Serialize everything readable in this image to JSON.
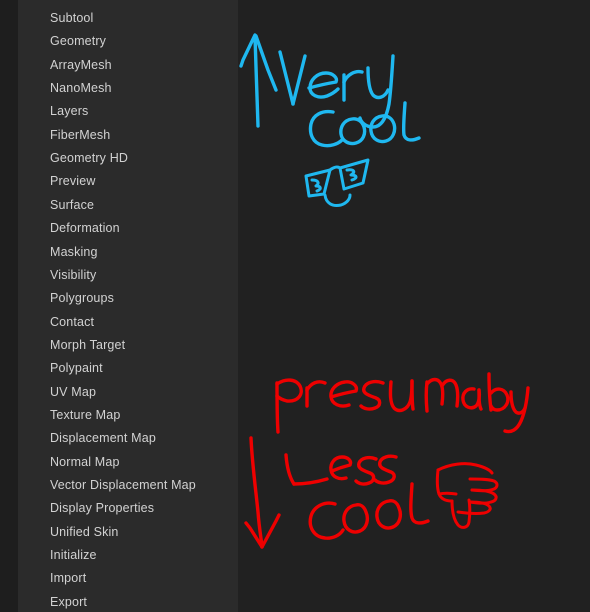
{
  "window": {
    "background_color": "#212121",
    "panel_color": "#2b2b2b",
    "gutter_color": "#1e1e1e",
    "text_color": "#d2d2d2"
  },
  "menu": {
    "name": "tool-palette-menu",
    "items": [
      {
        "label": "Subtool"
      },
      {
        "label": "Geometry"
      },
      {
        "label": "ArrayMesh"
      },
      {
        "label": "NanoMesh"
      },
      {
        "label": "Layers"
      },
      {
        "label": "FiberMesh"
      },
      {
        "label": "Geometry HD"
      },
      {
        "label": "Preview"
      },
      {
        "label": "Surface"
      },
      {
        "label": "Deformation"
      },
      {
        "label": "Masking"
      },
      {
        "label": "Visibility"
      },
      {
        "label": "Polygroups"
      },
      {
        "label": "Contact"
      },
      {
        "label": "Morph Target"
      },
      {
        "label": "Polypaint"
      },
      {
        "label": "UV Map"
      },
      {
        "label": "Texture Map"
      },
      {
        "label": "Displacement Map"
      },
      {
        "label": "Normal Map"
      },
      {
        "label": "Vector Displacement Map"
      },
      {
        "label": "Display Properties"
      },
      {
        "label": "Unified Skin"
      },
      {
        "label": "Initialize"
      },
      {
        "label": "Import"
      },
      {
        "label": "Export"
      }
    ]
  },
  "annotations": {
    "blue": {
      "color": "#1fb8f0",
      "line1": "Very",
      "line2": "Cool",
      "arrow": "up-arrow",
      "doodle": "sunglasses-smiley-face"
    },
    "red": {
      "color": "#ee0000",
      "line1": "Presumably",
      "line2": "Less",
      "line3": "Cool",
      "arrow": "down-arrow",
      "doodle": "thumbs-down-hand"
    }
  }
}
